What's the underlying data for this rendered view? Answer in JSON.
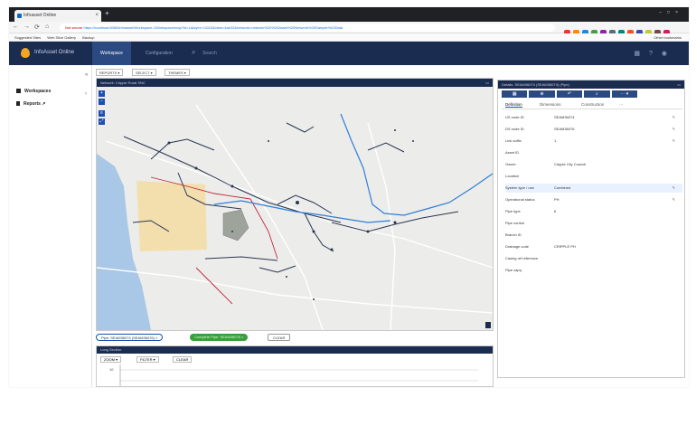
{
  "browser": {
    "tab_title": "Infoasset Online",
    "url_prefix": "Not secure",
    "url": "https://localhost:8080/infoasset/Workspace-1Workspace/map?id=1&layer=14113&view=4ab20&network=network%20%20Asset%20Network%20Sample%20Data",
    "bookmarks": [
      "Suggested Sites",
      "Web Slice Gallery",
      "Backup"
    ],
    "other_bookmarks": "Other bookmarks",
    "ext_colors": [
      "#e53935",
      "#fb8c00",
      "#1e88e5",
      "#43a047",
      "#8e24aa",
      "#546e7a",
      "#00897b",
      "#f4511e",
      "#3949ab",
      "#c0ca33",
      "#6d4c41",
      "#d81b60"
    ]
  },
  "app": {
    "title": "InfoAsset Online",
    "nav": {
      "workspace": "Workspace",
      "configuration": "Configuration"
    },
    "search_placeholder": "Search",
    "header_icons": [
      "grid-icon",
      "help-icon",
      "user-icon"
    ]
  },
  "sidebar": {
    "items": [
      {
        "label": "Workspaces"
      },
      {
        "label": "Reports"
      }
    ]
  },
  "toolbar": {
    "items": [
      "REPORTS ▾",
      "SELECT ▾",
      "THEMES ▾"
    ]
  },
  "map_panel": {
    "title": "Network: Cripple Rural SNC",
    "zoom_in": "+",
    "zoom_out": "−"
  },
  "selection_bar": {
    "chip1": "Pipe: SEAM36074 (SEAM36076) ×",
    "chip2": "Complete Pipe: SEAM36076 ×",
    "clear": "CLEAR"
  },
  "long_section": {
    "title": "Long Section",
    "buttons": [
      "ZOOM ▾",
      "FILTER ▾",
      "CLEAR"
    ],
    "tick": "10"
  },
  "details": {
    "title": "Details: SEAM36074 (SEAM36074) (Pipe)",
    "tools": [
      "▦",
      "⊕",
      "↶",
      "⌕",
      "⋯ ▾"
    ],
    "tabs": [
      "Definition",
      "Dimensions",
      "Construction",
      "···"
    ],
    "rows": [
      {
        "label": "US node ID",
        "value": "SEAM36074",
        "edit": "✎"
      },
      {
        "label": "DS node ID",
        "value": "SEAM36076",
        "edit": "✎"
      },
      {
        "label": "Link suffix",
        "value": "1",
        "edit": "✎"
      },
      {
        "label": "Asset ID",
        "value": "",
        "edit": ""
      },
      {
        "label": "Owner",
        "value": "Cripple City Council",
        "edit": ""
      },
      {
        "label": "Location",
        "value": "",
        "edit": ""
      },
      {
        "label": "System type / use",
        "value": "Combined",
        "edit": "✎"
      },
      {
        "label": "Operational status",
        "value": "PH",
        "edit": "✎"
      },
      {
        "label": "Pipe type",
        "value": "6",
        "edit": ""
      },
      {
        "label": "Pipe control",
        "value": "",
        "edit": ""
      },
      {
        "label": "Branch ID",
        "value": "",
        "edit": ""
      },
      {
        "label": "Drainage code",
        "value": "CRIPPLE PH",
        "edit": ""
      },
      {
        "label": "Casing ref reference",
        "value": "",
        "edit": ""
      },
      {
        "label": "Pipe capq",
        "value": "",
        "edit": ""
      }
    ]
  }
}
